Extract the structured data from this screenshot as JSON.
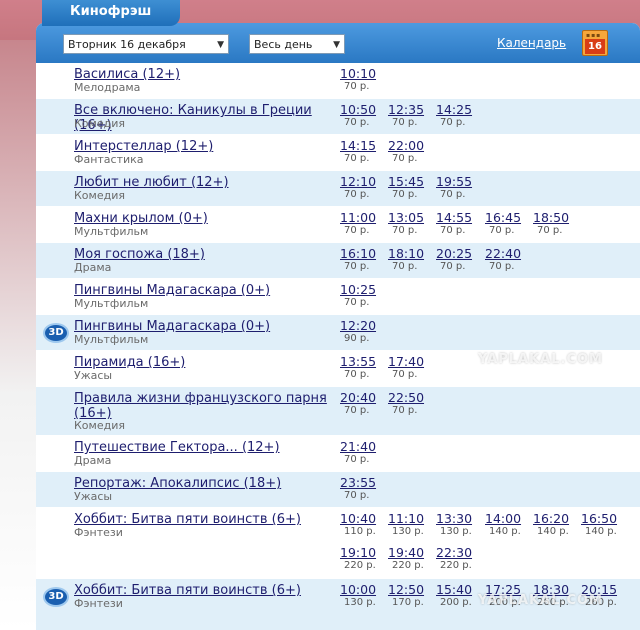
{
  "cinema_name": "Кинофрэш",
  "filters": {
    "date": "Вторник 16 декабря",
    "time_range": "Весь день"
  },
  "calendar": {
    "label": "Календарь",
    "day": "16"
  },
  "watermarks": [
    "YAPLAKAL.COM",
    "YAPLAKAL.COM"
  ],
  "movies": [
    {
      "title": "Василиса (12+)",
      "genre": "Мелодрама",
      "sessions": [
        {
          "time": "10:10",
          "price": "70 р."
        }
      ]
    },
    {
      "title": "Все включено: Каникулы в Греции (16+)",
      "genre": "Комедия",
      "sessions": [
        {
          "time": "10:50",
          "price": "70 р."
        },
        {
          "time": "12:35",
          "price": "70 р."
        },
        {
          "time": "14:25",
          "price": "70 р."
        }
      ]
    },
    {
      "title": "Интерстеллар (12+)",
      "genre": "Фантастика",
      "sessions": [
        {
          "time": "14:15",
          "price": "70 р."
        },
        {
          "time": "22:00",
          "price": "70 р."
        }
      ]
    },
    {
      "title": "Любит не любит (12+)",
      "genre": "Комедия",
      "sessions": [
        {
          "time": "12:10",
          "price": "70 р."
        },
        {
          "time": "15:45",
          "price": "70 р."
        },
        {
          "time": "19:55",
          "price": "70 р."
        }
      ]
    },
    {
      "title": "Махни крылом (0+)",
      "genre": "Мультфильм",
      "sessions": [
        {
          "time": "11:00",
          "price": "70 р."
        },
        {
          "time": "13:05",
          "price": "70 р."
        },
        {
          "time": "14:55",
          "price": "70 р."
        },
        {
          "time": "16:45",
          "price": "70 р."
        },
        {
          "time": "18:50",
          "price": "70 р."
        }
      ]
    },
    {
      "title": "Моя госпожа (18+)",
      "genre": "Драма",
      "sessions": [
        {
          "time": "16:10",
          "price": "70 р."
        },
        {
          "time": "18:10",
          "price": "70 р."
        },
        {
          "time": "20:25",
          "price": "70 р."
        },
        {
          "time": "22:40",
          "price": "70 р."
        }
      ]
    },
    {
      "title": "Пингвины Мадагаскара (0+)",
      "genre": "Мультфильм",
      "sessions": [
        {
          "time": "10:25",
          "price": "70 р."
        }
      ]
    },
    {
      "title": "Пингвины Мадагаскара (0+)",
      "genre": "Мультфильм",
      "badge": "3D",
      "sessions": [
        {
          "time": "12:20",
          "price": "90 р."
        }
      ]
    },
    {
      "title": "Пирамида (16+)",
      "genre": "Ужасы",
      "sessions": [
        {
          "time": "13:55",
          "price": "70 р."
        },
        {
          "time": "17:40",
          "price": "70 р."
        }
      ]
    },
    {
      "title": "Правила жизни французского парня (16+)",
      "genre": "Комедия",
      "sessions": [
        {
          "time": "20:40",
          "price": "70 р."
        },
        {
          "time": "22:50",
          "price": "70 р."
        }
      ]
    },
    {
      "title": "Путешествие Гектора... (12+)",
      "genre": "Драма",
      "sessions": [
        {
          "time": "21:40",
          "price": "70 р."
        }
      ]
    },
    {
      "title": "Репортаж: Апокалипсис (18+)",
      "genre": "Ужасы",
      "sessions": [
        {
          "time": "23:55",
          "price": "70 р."
        }
      ]
    },
    {
      "title": "Хоббит: Битва пяти воинств (6+)",
      "genre": "Фэнтези",
      "sessions": [
        {
          "time": "10:40",
          "price": "110 р."
        },
        {
          "time": "11:10",
          "price": "130 р."
        },
        {
          "time": "13:30",
          "price": "130 р."
        },
        {
          "time": "14:00",
          "price": "140 р."
        },
        {
          "time": "16:20",
          "price": "140 р."
        },
        {
          "time": "16:50",
          "price": "140 р."
        },
        {
          "time": "19:10",
          "price": "220 р."
        },
        {
          "time": "19:40",
          "price": "220 р."
        },
        {
          "time": "22:30",
          "price": "220 р."
        }
      ]
    },
    {
      "title": "Хоббит: Битва пяти воинств (6+)",
      "genre": "Фэнтези",
      "badge": "3D",
      "sessions": [
        {
          "time": "10:00",
          "price": "130 р."
        },
        {
          "time": "12:50",
          "price": "170 р."
        },
        {
          "time": "15:40",
          "price": "200 р."
        },
        {
          "time": "17:25",
          "price": "200 р."
        },
        {
          "time": "18:30",
          "price": "260 р."
        },
        {
          "time": "20:15",
          "price": "260 р."
        }
      ]
    }
  ]
}
